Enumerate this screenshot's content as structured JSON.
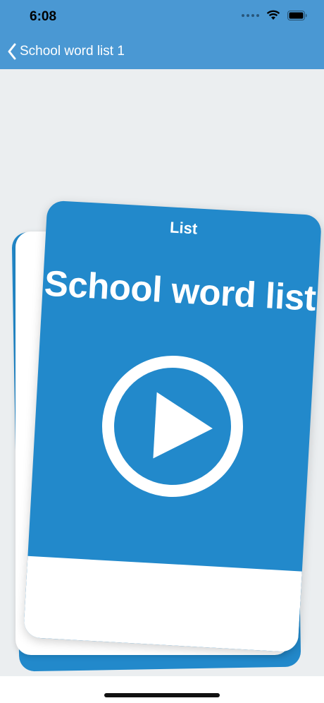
{
  "status_bar": {
    "time": "6:08"
  },
  "nav": {
    "back_label": "School word list 1"
  },
  "card": {
    "kind": "List",
    "title": "School word list"
  },
  "colors": {
    "nav_blue": "#4a98d3",
    "card_blue": "#2289cb",
    "background": "#ebeef0"
  },
  "icons": {
    "back": "chevron-left-icon",
    "play": "play-icon",
    "wifi": "wifi-icon",
    "battery": "battery-icon"
  }
}
